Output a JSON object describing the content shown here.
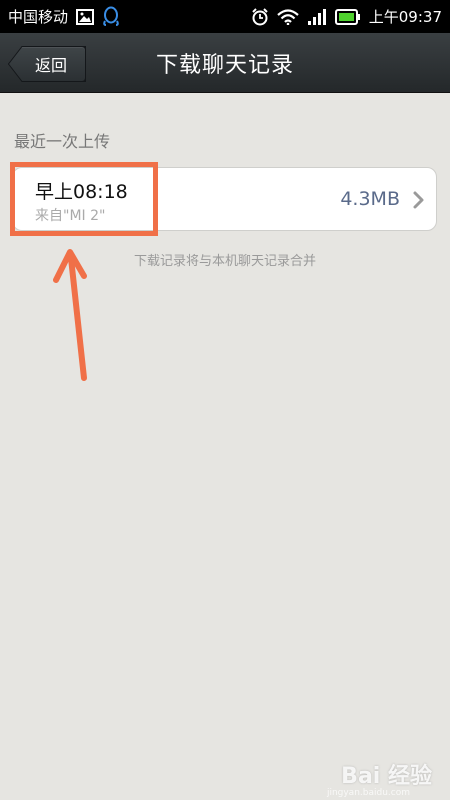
{
  "status_bar": {
    "carrier": "中国移动",
    "time": "上午09:37",
    "icons": [
      "image-icon",
      "qq-icon",
      "alarm-icon",
      "wifi-icon",
      "signal-icon",
      "battery-icon"
    ]
  },
  "header": {
    "back_label": "返回",
    "title": "下载聊天记录"
  },
  "section": {
    "label": "最近一次上传"
  },
  "record": {
    "time": "早上08:18",
    "source": "来自\"MI 2\"",
    "size": "4.3MB"
  },
  "hint": "下载记录将与本机聊天记录合并",
  "annotation": {
    "highlight_color": "#f07048"
  },
  "watermark": {
    "brand": "Bai 经验",
    "url": "jingyan.baidu.com"
  },
  "colors": {
    "background": "#e6e5e1",
    "title_bar": "#2d3134",
    "size_text": "#5a6a8a"
  }
}
